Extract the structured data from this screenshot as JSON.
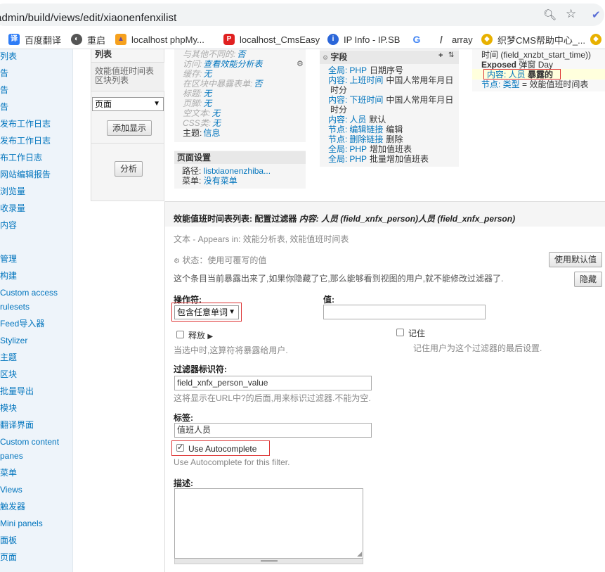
{
  "browser": {
    "url": "admin/build/views/edit/xiaonenfenxilist",
    "bookmarks": [
      "百度翻译",
      "重启",
      "localhost phpMy...",
      "localhost_CmsEasy",
      "IP Info - IP.SB",
      "array",
      "织梦CMS帮助中心_..."
    ],
    "icons": [
      "zoom-icon",
      "star-icon"
    ]
  },
  "sidebar": {
    "items": [
      "列表",
      "告",
      "告",
      "告",
      "发布工作日志",
      "发布工作日志",
      "布工作日志",
      "网站编辑报告",
      "浏览量",
      "收录量",
      "内容",
      "管理",
      "构建",
      "Custom access",
      "rulesets",
      "Feed导入器",
      "Stylizer",
      "主题",
      "区块",
      "批量导出",
      "模块",
      "翻译界面",
      "Custom content",
      "panes",
      "菜单",
      "Views",
      "触发器",
      "Mini panels",
      "面板",
      "页面"
    ]
  },
  "midcol": {
    "title": "列表",
    "subtitle": "效能值班时间表区块列表",
    "display_select": "页面",
    "add_display": "添加显示",
    "analyze": "分析"
  },
  "basic": {
    "rows": [
      {
        "k": "与其他不同的:",
        "v": "否"
      },
      {
        "k": "访问:",
        "v": "查看效能分析表"
      },
      {
        "k": "缓存:",
        "v": "无"
      },
      {
        "k": "在区块中暴露表单:",
        "v": "否"
      },
      {
        "k": "标题:",
        "v": "无"
      },
      {
        "k": "页脚:",
        "v": "无"
      },
      {
        "k": "空文本:",
        "v": "无"
      },
      {
        "k": "CSS类:",
        "v": "无"
      },
      {
        "k": "主题:",
        "v": "信息"
      }
    ],
    "page_settings_title": "页面设置",
    "path_label": "路径:",
    "path_value": "listxiaonenzhiba...",
    "menu_label": "菜单:",
    "menu_value": "没有菜单"
  },
  "fields": {
    "title": "字段",
    "items": [
      {
        "prefix": "全局:",
        "name": "PHP",
        "suffix": "日期序号"
      },
      {
        "prefix": "内容:",
        "name": "上班时间",
        "suffix": "中国人常用年月日"
      },
      {
        "prefix": "",
        "name": "",
        "suffix": "时分"
      },
      {
        "prefix": "内容:",
        "name": "下班时间",
        "suffix": "中国人常用年月日"
      },
      {
        "prefix": "",
        "name": "",
        "suffix": "时分"
      },
      {
        "prefix": "内容:",
        "name": "人员",
        "suffix": "默认"
      },
      {
        "prefix": "节点:",
        "name": "编辑链接",
        "suffix": "编辑"
      },
      {
        "prefix": "节点:",
        "name": "删除链接",
        "suffix": "删除"
      },
      {
        "prefix": "全局:",
        "name": "PHP",
        "suffix": "增加值班表"
      },
      {
        "prefix": "全局:",
        "name": "PHP",
        "suffix": "批量增加值班表"
      }
    ]
  },
  "filters": {
    "line1": "时间 (field_xnzbt_start_time))",
    "exposed_label": "Exposed",
    "exposed_value": "弹窗 Day",
    "person_filter": "内容: 人员",
    "person_filter_suffix": "暴露的",
    "node_type": "节点: 类型",
    "node_type_suffix": "= 效能值班时间表"
  },
  "config": {
    "heading_prefix": "效能值班时间表列表: 配置过滤器",
    "heading_italic": "内容: 人员 (field_xnfx_person)人员 (field_xnfx_person)",
    "text_line": "文本 - Appears in: 效能分析表, 效能值班时间表",
    "status": "状态：使用可覆写的值",
    "use_default": "使用默认值",
    "exposed_note": "这个条目当前暴露出来了,如果你隐藏了它,那么能够看到视图的用户,就不能修改过滤器了.",
    "hide": "隐藏",
    "operator_label": "操作符:",
    "operator_value": "包含任意单词",
    "value_label": "值:",
    "value_input": "",
    "release_label": "释放",
    "release_desc": "当选中时,这算符将暴露给用户.",
    "remember_label": "记住",
    "remember_desc": "记住用户为这个过滤器的最后设置.",
    "identifier_label": "过滤器标识符:",
    "identifier_value": "field_xnfx_person_value",
    "identifier_desc": "这将显示在URL中?的后面,用来标识过滤器.不能为空.",
    "tag_label": "标签:",
    "tag_value": "值班人员",
    "autocomplete_label": "Use Autocomplete",
    "autocomplete_checked": true,
    "autocomplete_desc": "Use Autocomplete for this filter.",
    "description_label": "描述:"
  }
}
